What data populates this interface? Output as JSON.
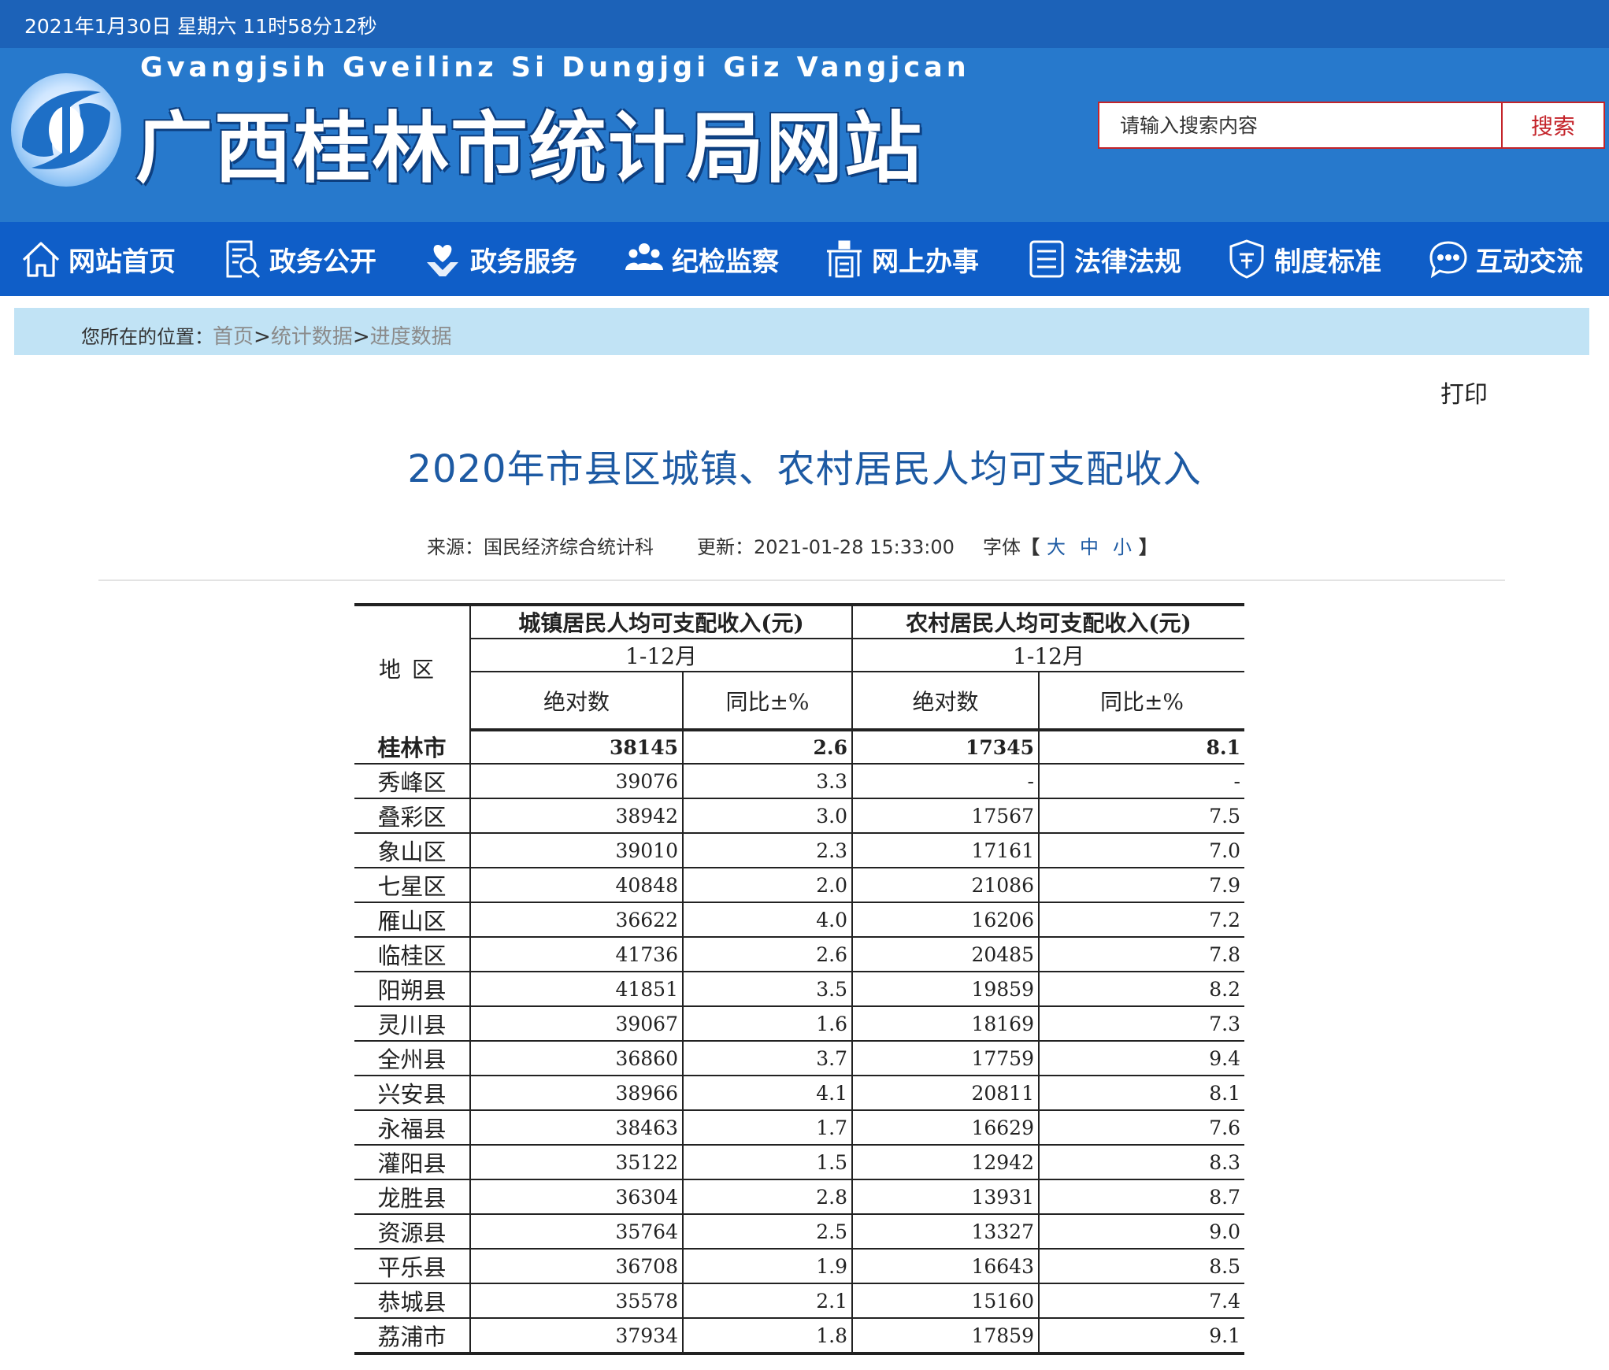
{
  "topbar": {
    "datetime": "2021年1月30日 星期六 11时58分12秒"
  },
  "header": {
    "pinyin": "Gvangjsih Gveilinz Si Dungjgi Giz Vangjcan",
    "site_title": "广西桂林市统计局网站",
    "search": {
      "placeholder": "请输入搜索内容",
      "button": "搜索"
    }
  },
  "nav": {
    "items": [
      {
        "label": "网站首页",
        "icon": "home-icon"
      },
      {
        "label": "政务公开",
        "icon": "document-search-icon"
      },
      {
        "label": "政务服务",
        "icon": "heart-hand-icon"
      },
      {
        "label": "纪检监察",
        "icon": "people-group-icon"
      },
      {
        "label": "网上办事",
        "icon": "office-desk-icon"
      },
      {
        "label": "法律法规",
        "icon": "list-document-icon"
      },
      {
        "label": "制度标准",
        "icon": "shield-badge-icon"
      },
      {
        "label": "互动交流",
        "icon": "chat-bubble-icon"
      }
    ]
  },
  "breadcrumb": {
    "prefix": "您所在的位置：",
    "items": [
      "首页",
      "统计数据",
      "进度数据"
    ],
    "separator": ">"
  },
  "article": {
    "print": "打印",
    "title": "2020年市县区城镇、农村居民人均可支配收入",
    "source": "来源：国民经济综合统计科",
    "updated": "更新：2021-01-28 15:33:00",
    "font_label": "字体",
    "font_open": "【",
    "font_close": "】",
    "font_sizes": [
      "大",
      "中",
      "小"
    ]
  },
  "table": {
    "region_header": "地区",
    "urban_header": "城镇居民人均可支配收入(元)",
    "rural_header": "农村居民人均可支配收入(元)",
    "period": "1-12月",
    "abs_header": "绝对数",
    "yoy_header": "同比±%",
    "rows": [
      {
        "region": "桂林市",
        "urban_abs": "38145",
        "urban_yoy": "2.6",
        "rural_abs": "17345",
        "rural_yoy": "8.1"
      },
      {
        "region": "秀峰区",
        "urban_abs": "39076",
        "urban_yoy": "3.3",
        "rural_abs": "-",
        "rural_yoy": "-"
      },
      {
        "region": "叠彩区",
        "urban_abs": "38942",
        "urban_yoy": "3.0",
        "rural_abs": "17567",
        "rural_yoy": "7.5"
      },
      {
        "region": "象山区",
        "urban_abs": "39010",
        "urban_yoy": "2.3",
        "rural_abs": "17161",
        "rural_yoy": "7.0"
      },
      {
        "region": "七星区",
        "urban_abs": "40848",
        "urban_yoy": "2.0",
        "rural_abs": "21086",
        "rural_yoy": "7.9"
      },
      {
        "region": "雁山区",
        "urban_abs": "36622",
        "urban_yoy": "4.0",
        "rural_abs": "16206",
        "rural_yoy": "7.2"
      },
      {
        "region": "临桂区",
        "urban_abs": "41736",
        "urban_yoy": "2.6",
        "rural_abs": "20485",
        "rural_yoy": "7.8"
      },
      {
        "region": "阳朔县",
        "urban_abs": "41851",
        "urban_yoy": "3.5",
        "rural_abs": "19859",
        "rural_yoy": "8.2"
      },
      {
        "region": "灵川县",
        "urban_abs": "39067",
        "urban_yoy": "1.6",
        "rural_abs": "18169",
        "rural_yoy": "7.3"
      },
      {
        "region": "全州县",
        "urban_abs": "36860",
        "urban_yoy": "3.7",
        "rural_abs": "17759",
        "rural_yoy": "9.4"
      },
      {
        "region": "兴安县",
        "urban_abs": "38966",
        "urban_yoy": "4.1",
        "rural_abs": "20811",
        "rural_yoy": "8.1"
      },
      {
        "region": "永福县",
        "urban_abs": "38463",
        "urban_yoy": "1.7",
        "rural_abs": "16629",
        "rural_yoy": "7.6"
      },
      {
        "region": "灌阳县",
        "urban_abs": "35122",
        "urban_yoy": "1.5",
        "rural_abs": "12942",
        "rural_yoy": "8.3"
      },
      {
        "region": "龙胜县",
        "urban_abs": "36304",
        "urban_yoy": "2.8",
        "rural_abs": "13931",
        "rural_yoy": "8.7"
      },
      {
        "region": "资源县",
        "urban_abs": "35764",
        "urban_yoy": "2.5",
        "rural_abs": "13327",
        "rural_yoy": "9.0"
      },
      {
        "region": "平乐县",
        "urban_abs": "36708",
        "urban_yoy": "1.9",
        "rural_abs": "16643",
        "rural_yoy": "8.5"
      },
      {
        "region": "恭城县",
        "urban_abs": "35578",
        "urban_yoy": "2.1",
        "rural_abs": "15160",
        "rural_yoy": "7.4"
      },
      {
        "region": "荔浦市",
        "urban_abs": "37934",
        "urban_yoy": "1.8",
        "rural_abs": "17859",
        "rural_yoy": "9.1"
      }
    ]
  },
  "colors": {
    "topbar": "#1c62b8",
    "header": "#2779cc",
    "nav": "#0f5ec8",
    "breadcrumb_bg": "#c1e3f5",
    "title": "#1d5aa3",
    "search_accent": "#c4242a"
  }
}
